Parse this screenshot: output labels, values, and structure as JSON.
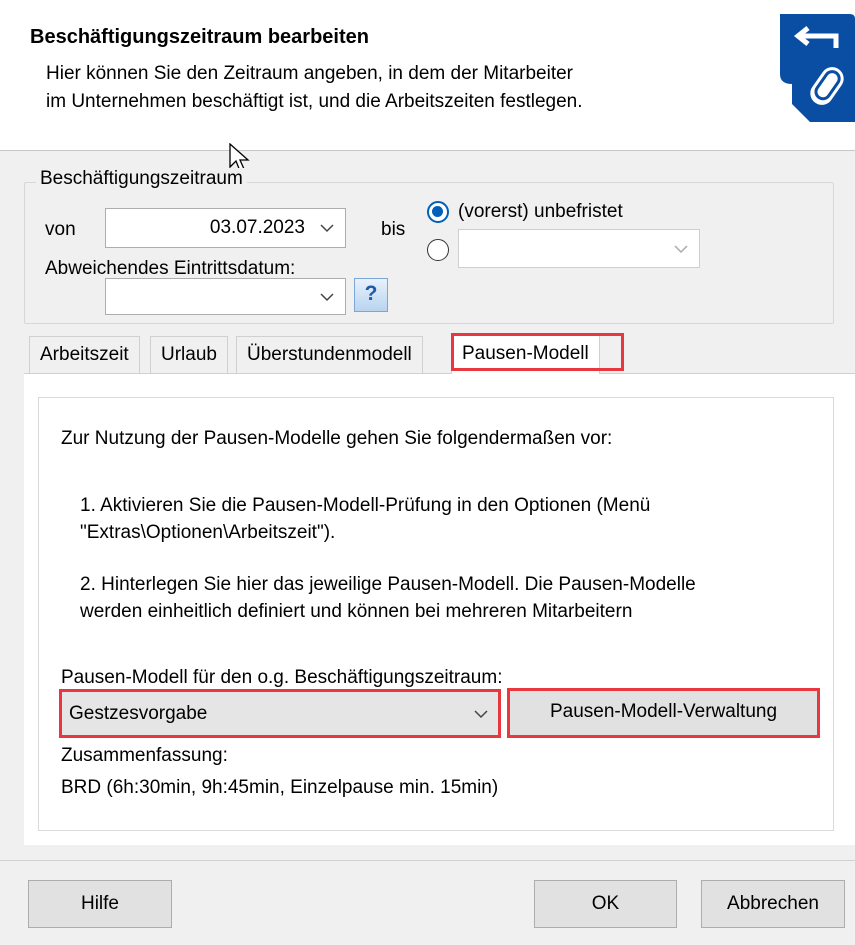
{
  "header": {
    "title": "Beschäftigungszeitraum bearbeiten",
    "subtitle_line1": "Hier können Sie den Zeitraum angeben, in dem der Mitarbeiter",
    "subtitle_line2": "im Unternehmen beschäftigt ist, und die Arbeitszeiten festlegen."
  },
  "period": {
    "group_title": "Beschäftigungszeitraum",
    "from_label": "von",
    "from_value": "03.07.2023",
    "to_label": "bis",
    "unlimited_label": "(vorerst) unbefristet",
    "unlimited_checked": true,
    "end_date_value": "",
    "entry_date_label": "Abweichendes Eintrittsdatum:",
    "entry_date_value": "",
    "help_glyph": "?"
  },
  "tabs": [
    {
      "label": "Arbeitszeit",
      "active": false
    },
    {
      "label": "Urlaub",
      "active": false
    },
    {
      "label": "Überstundenmodell",
      "active": false
    },
    {
      "label": "Pausen-Modell",
      "active": true
    }
  ],
  "break_model": {
    "intro": "Zur Nutzung der Pausen-Modelle gehen Sie folgendermaßen vor:",
    "step1_line1": "1. Aktivieren Sie die Pausen-Modell-Prüfung in den Optionen (Menü",
    "step1_line2": "\"Extras\\Optionen\\Arbeitszeit\").",
    "step2_line1": "2. Hinterlegen Sie hier das jeweilige Pausen-Modell. Die Pausen-Modelle",
    "step2_line2": "werden einheitlich definiert und können bei mehreren Mitarbeitern",
    "select_label": "Pausen-Modell für den o.g. Beschäftigungszeitraum:",
    "selected_model": "Gestzesvorgabe",
    "manage_button": "Pausen-Modell-Verwaltung",
    "summary_label": "Zusammenfassung:",
    "summary_value": "BRD (6h:30min, 9h:45min, Einzelpause min. 15min)"
  },
  "footer": {
    "help_button": "Hilfe",
    "ok_button": "OK",
    "cancel_button": "Abbrechen"
  },
  "colors": {
    "accent": "#005fb8",
    "highlight": "#e8373e",
    "logo_blue": "#0a4ea3"
  },
  "icons": [
    "logo-icon",
    "cursor-icon",
    "chevron-down-icon",
    "help-icon"
  ]
}
